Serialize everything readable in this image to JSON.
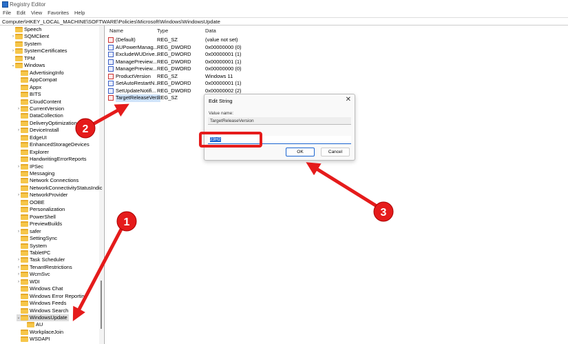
{
  "window": {
    "title": "Registry Editor"
  },
  "menu": [
    "File",
    "Edit",
    "View",
    "Favorites",
    "Help"
  ],
  "address": "Computer\\HKEY_LOCAL_MACHINE\\SOFTWARE\\Policies\\Microsoft\\Windows\\WindowsUpdate",
  "tree": [
    {
      "label": "Speech",
      "depth": 0,
      "exp": ""
    },
    {
      "label": "SQMClient",
      "depth": 0,
      "exp": ">"
    },
    {
      "label": "System",
      "depth": 0,
      "exp": ""
    },
    {
      "label": "SystemCertificates",
      "depth": 0,
      "exp": ">"
    },
    {
      "label": "TPM",
      "depth": 0,
      "exp": ""
    },
    {
      "label": "Windows",
      "depth": 0,
      "exp": "v"
    },
    {
      "label": "AdvertisingInfo",
      "depth": 1,
      "exp": ""
    },
    {
      "label": "AppCompat",
      "depth": 1,
      "exp": ""
    },
    {
      "label": "Appx",
      "depth": 1,
      "exp": ""
    },
    {
      "label": "BITS",
      "depth": 1,
      "exp": ""
    },
    {
      "label": "CloudContent",
      "depth": 1,
      "exp": ""
    },
    {
      "label": "CurrentVersion",
      "depth": 1,
      "exp": ">"
    },
    {
      "label": "DataCollection",
      "depth": 1,
      "exp": ""
    },
    {
      "label": "DeliveryOptimization",
      "depth": 1,
      "exp": ""
    },
    {
      "label": "DeviceInstall",
      "depth": 1,
      "exp": ">"
    },
    {
      "label": "EdgeUI",
      "depth": 1,
      "exp": ""
    },
    {
      "label": "EnhancedStorageDevices",
      "depth": 1,
      "exp": ""
    },
    {
      "label": "Explorer",
      "depth": 1,
      "exp": ""
    },
    {
      "label": "HandwritingErrorReports",
      "depth": 1,
      "exp": ""
    },
    {
      "label": "IPSec",
      "depth": 1,
      "exp": ">"
    },
    {
      "label": "Messaging",
      "depth": 1,
      "exp": ""
    },
    {
      "label": "Network Connections",
      "depth": 1,
      "exp": ""
    },
    {
      "label": "NetworkConnectivityStatusIndic",
      "depth": 1,
      "exp": ""
    },
    {
      "label": "NetworkProvider",
      "depth": 1,
      "exp": ">"
    },
    {
      "label": "OOBE",
      "depth": 1,
      "exp": ""
    },
    {
      "label": "Personalization",
      "depth": 1,
      "exp": ""
    },
    {
      "label": "PowerShell",
      "depth": 1,
      "exp": ""
    },
    {
      "label": "PreviewBuilds",
      "depth": 1,
      "exp": ""
    },
    {
      "label": "safer",
      "depth": 1,
      "exp": ">"
    },
    {
      "label": "SettingSync",
      "depth": 1,
      "exp": ""
    },
    {
      "label": "System",
      "depth": 1,
      "exp": ""
    },
    {
      "label": "TabletPC",
      "depth": 1,
      "exp": ""
    },
    {
      "label": "Task Scheduler",
      "depth": 1,
      "exp": ">"
    },
    {
      "label": "TenantRestrictions",
      "depth": 1,
      "exp": ">"
    },
    {
      "label": "WcmSvc",
      "depth": 1,
      "exp": ">"
    },
    {
      "label": "WDI",
      "depth": 1,
      "exp": ">"
    },
    {
      "label": "Windows Chat",
      "depth": 1,
      "exp": ""
    },
    {
      "label": "Windows Error Reporting",
      "depth": 1,
      "exp": ""
    },
    {
      "label": "Windows Feeds",
      "depth": 1,
      "exp": ""
    },
    {
      "label": "Windows Search",
      "depth": 1,
      "exp": ""
    },
    {
      "label": "WindowsUpdate",
      "depth": 1,
      "exp": "v",
      "selected": true
    },
    {
      "label": "AU",
      "depth": 2,
      "exp": ""
    },
    {
      "label": "WorkplaceJoin",
      "depth": 1,
      "exp": ""
    },
    {
      "label": "WSDAPI",
      "depth": 1,
      "exp": ""
    }
  ],
  "list": {
    "headers": {
      "name": "Name",
      "type": "Type",
      "data": "Data"
    },
    "rows": [
      {
        "name": "(Default)",
        "type": "REG_SZ",
        "data": "(value not set)"
      },
      {
        "name": "AUPowerManag...",
        "type": "REG_DWORD",
        "data": "0x00000000 (0)"
      },
      {
        "name": "ExcludeWUDrive...",
        "type": "REG_DWORD",
        "data": "0x00000001 (1)"
      },
      {
        "name": "ManagePreview...",
        "type": "REG_DWORD",
        "data": "0x00000001 (1)"
      },
      {
        "name": "ManagePreview...",
        "type": "REG_DWORD",
        "data": "0x00000000 (0)"
      },
      {
        "name": "ProductVersion",
        "type": "REG_SZ",
        "data": "Windows 11"
      },
      {
        "name": "SetAutoRestartN...",
        "type": "REG_DWORD",
        "data": "0x00000001 (1)"
      },
      {
        "name": "SetUpdateNotifi...",
        "type": "REG_DWORD",
        "data": "0x00000002 (2)"
      },
      {
        "name": "TargetReleaseVer...",
        "type": "REG_SZ",
        "data": ""
      }
    ]
  },
  "dialog": {
    "title": "Edit String",
    "value_name_label": "Value name:",
    "value_name": "TargetReleaseVersion",
    "value_data": "23H2",
    "ok": "OK",
    "cancel": "Cancel"
  },
  "annotations": {
    "step1": "1",
    "step2": "2",
    "step3": "3",
    "color": "#e51b1b"
  }
}
